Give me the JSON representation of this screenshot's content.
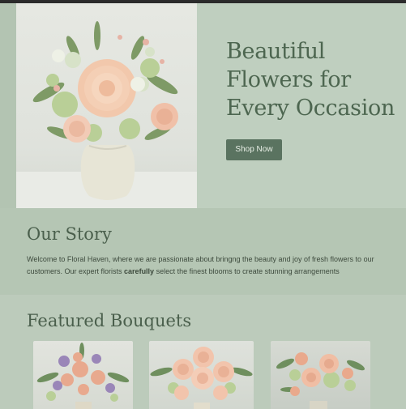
{
  "hero": {
    "title": "Beautiful\nFlowers for\nEvery Occasion",
    "button_label": "Shop Now",
    "image_alt": "Vase of peach dahlia and roses bouquet"
  },
  "story": {
    "title": "Our Story",
    "text_before_bold": "Welcome to Floral Haven, where we are passionate about bringng the beauty and joy of fresh flowers to our customers. Our expert florists ",
    "text_bold": "carefully",
    "text_after_bold": " select the finest blooms to create stunning arrangements"
  },
  "featured": {
    "title": "Featured Bouquets",
    "cards": [
      {
        "alt": "Mixed purple and peach bouquet"
      },
      {
        "alt": "Peach rose bouquet"
      },
      {
        "alt": "Peach rose and greenery bouquet"
      }
    ]
  },
  "colors": {
    "background": "#bccbbb",
    "heading": "#4d6650",
    "button": "#5a7360",
    "button_text": "#e8efe6",
    "flower_peach": "#f0c3a6",
    "foliage": "#6f8f5e"
  }
}
